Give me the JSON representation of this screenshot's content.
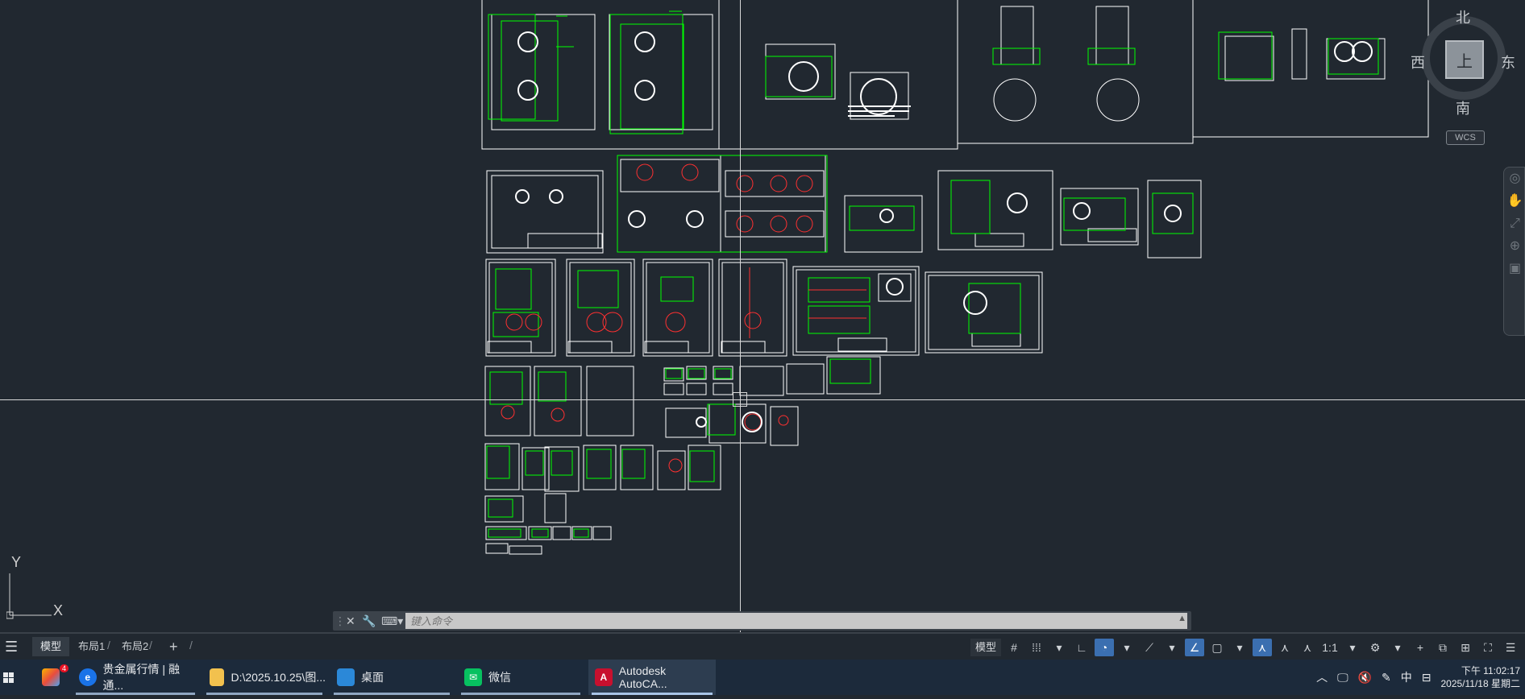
{
  "viewcube": {
    "north": "北",
    "south": "南",
    "west": "西",
    "east": "东",
    "face": "上",
    "wcs": "WCS"
  },
  "ucs": {
    "x": "X",
    "y": "Y"
  },
  "command": {
    "placeholder": "键入命令"
  },
  "tabs": [
    {
      "label": "模型"
    },
    {
      "label": "布局1"
    },
    {
      "label": "布局2"
    }
  ],
  "status": {
    "model_label": "模型",
    "scale": "1:1"
  },
  "taskbar": {
    "apps": [
      {
        "label": "贵金属行情 | 融通..."
      },
      {
        "label": "D:\\2025.10.25\\图..."
      },
      {
        "label": "桌面"
      },
      {
        "label": "微信"
      },
      {
        "label": "Autodesk AutoCA..."
      }
    ],
    "badge": "4",
    "ime": "中",
    "time": "下午 11:02:17",
    "date": "2025/11/18 星期二"
  },
  "colors": {
    "background": "#212830",
    "line_white": "#ffffff",
    "line_green": "#00ff00",
    "line_red": "#ff3030"
  }
}
